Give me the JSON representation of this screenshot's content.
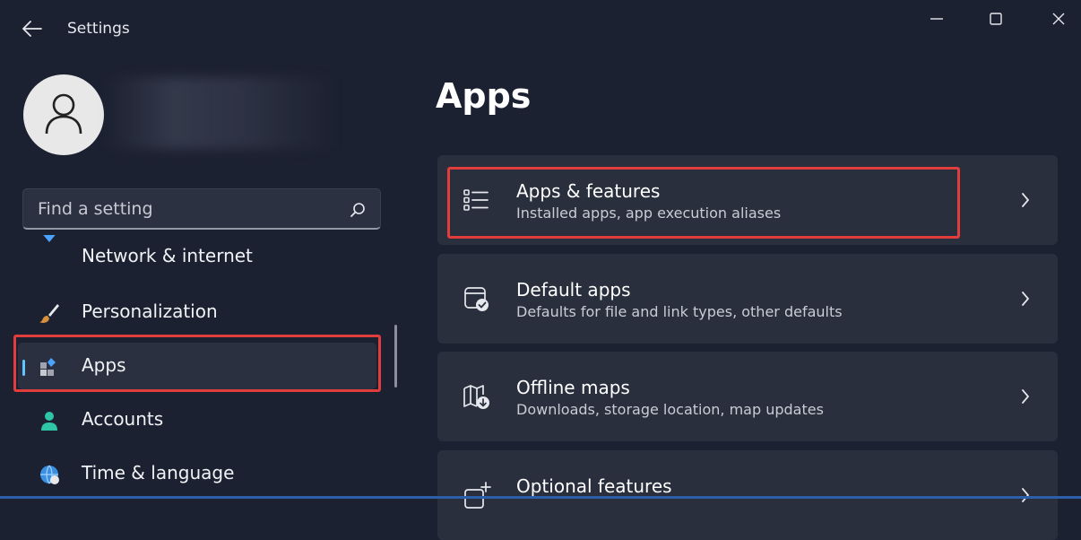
{
  "window": {
    "title": "Settings"
  },
  "sidebar": {
    "search_placeholder": "Find a setting",
    "items": [
      {
        "label": "Network & internet",
        "icon": "wifi-icon"
      },
      {
        "label": "Personalization",
        "icon": "paintbrush-icon"
      },
      {
        "label": "Apps",
        "icon": "apps-icon",
        "selected": true
      },
      {
        "label": "Accounts",
        "icon": "person-icon"
      },
      {
        "label": "Time & language",
        "icon": "globe-clock-icon"
      }
    ]
  },
  "main": {
    "title": "Apps",
    "cards": [
      {
        "title": "Apps & features",
        "subtitle": "Installed apps, app execution aliases",
        "icon": "list-icon",
        "highlighted": true
      },
      {
        "title": "Default apps",
        "subtitle": "Defaults for file and link types, other defaults",
        "icon": "default-apps-icon"
      },
      {
        "title": "Offline maps",
        "subtitle": "Downloads, storage location, map updates",
        "icon": "map-download-icon"
      },
      {
        "title": "Optional features",
        "subtitle": "",
        "icon": "add-feature-icon"
      }
    ]
  },
  "colors": {
    "background": "#1c2131",
    "card": "#2a2f3e",
    "accent": "#5fc6ff",
    "highlight": "#e23d3d"
  }
}
